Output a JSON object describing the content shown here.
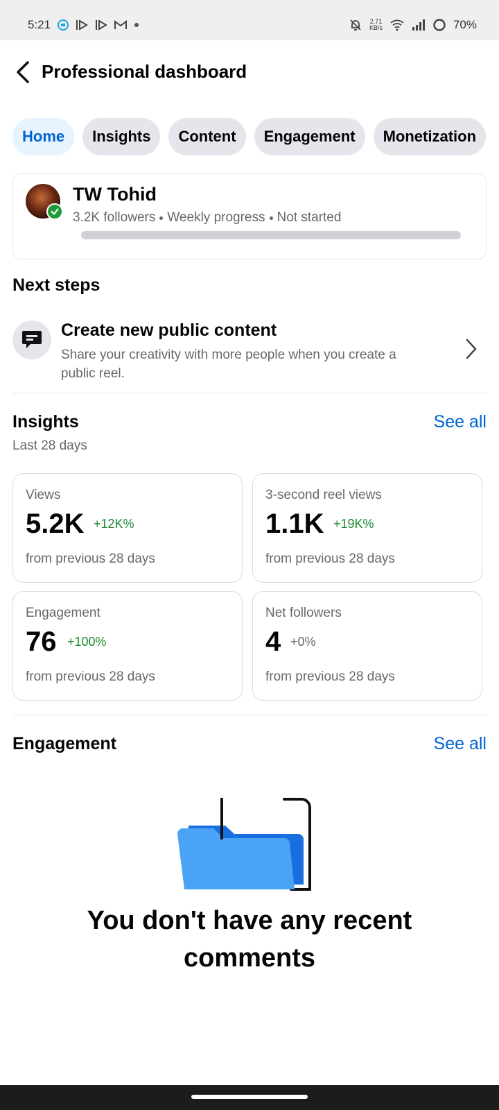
{
  "status_bar": {
    "time": "5:21",
    "kbs_value": "2.71",
    "kbs_unit": "KB/s",
    "battery": "70%"
  },
  "header": {
    "title": "Professional dashboard"
  },
  "tabs": [
    {
      "label": "Home",
      "active": true
    },
    {
      "label": "Insights",
      "active": false
    },
    {
      "label": "Content",
      "active": false
    },
    {
      "label": "Engagement",
      "active": false
    },
    {
      "label": "Monetization",
      "active": false
    }
  ],
  "profile": {
    "name": "TW Tohid",
    "followers": "3.2K followers",
    "progress_label": "Weekly progress",
    "progress_status": "Not started",
    "progress_fraction": 0
  },
  "next_steps": {
    "title": "Next steps",
    "item": {
      "title": "Create new public content",
      "description": "Share your creativity with more people when you create a public reel."
    }
  },
  "insights": {
    "title": "Insights",
    "see_all": "See all",
    "period": "Last 28 days",
    "metrics": [
      {
        "label": "Views",
        "value": "5.2K",
        "change": "+12K%",
        "foot": "from previous 28 days"
      },
      {
        "label": "3-second reel views",
        "value": "1.1K",
        "change": "+19K%",
        "foot": "from previous 28 days"
      },
      {
        "label": "Engagement",
        "value": "76",
        "change": "+100%",
        "foot": "from previous 28 days"
      },
      {
        "label": "Net followers",
        "value": "4",
        "change": "+0%",
        "foot": "from previous 28 days"
      }
    ]
  },
  "engagement": {
    "title": "Engagement",
    "see_all": "See all",
    "empty_message": "You don't have any recent comments"
  },
  "colors": {
    "accent": "#0064d1",
    "positive": "#1a8a2f",
    "tab_bg": "#e4e6eb",
    "tab_active_bg": "#e7f3ff"
  }
}
